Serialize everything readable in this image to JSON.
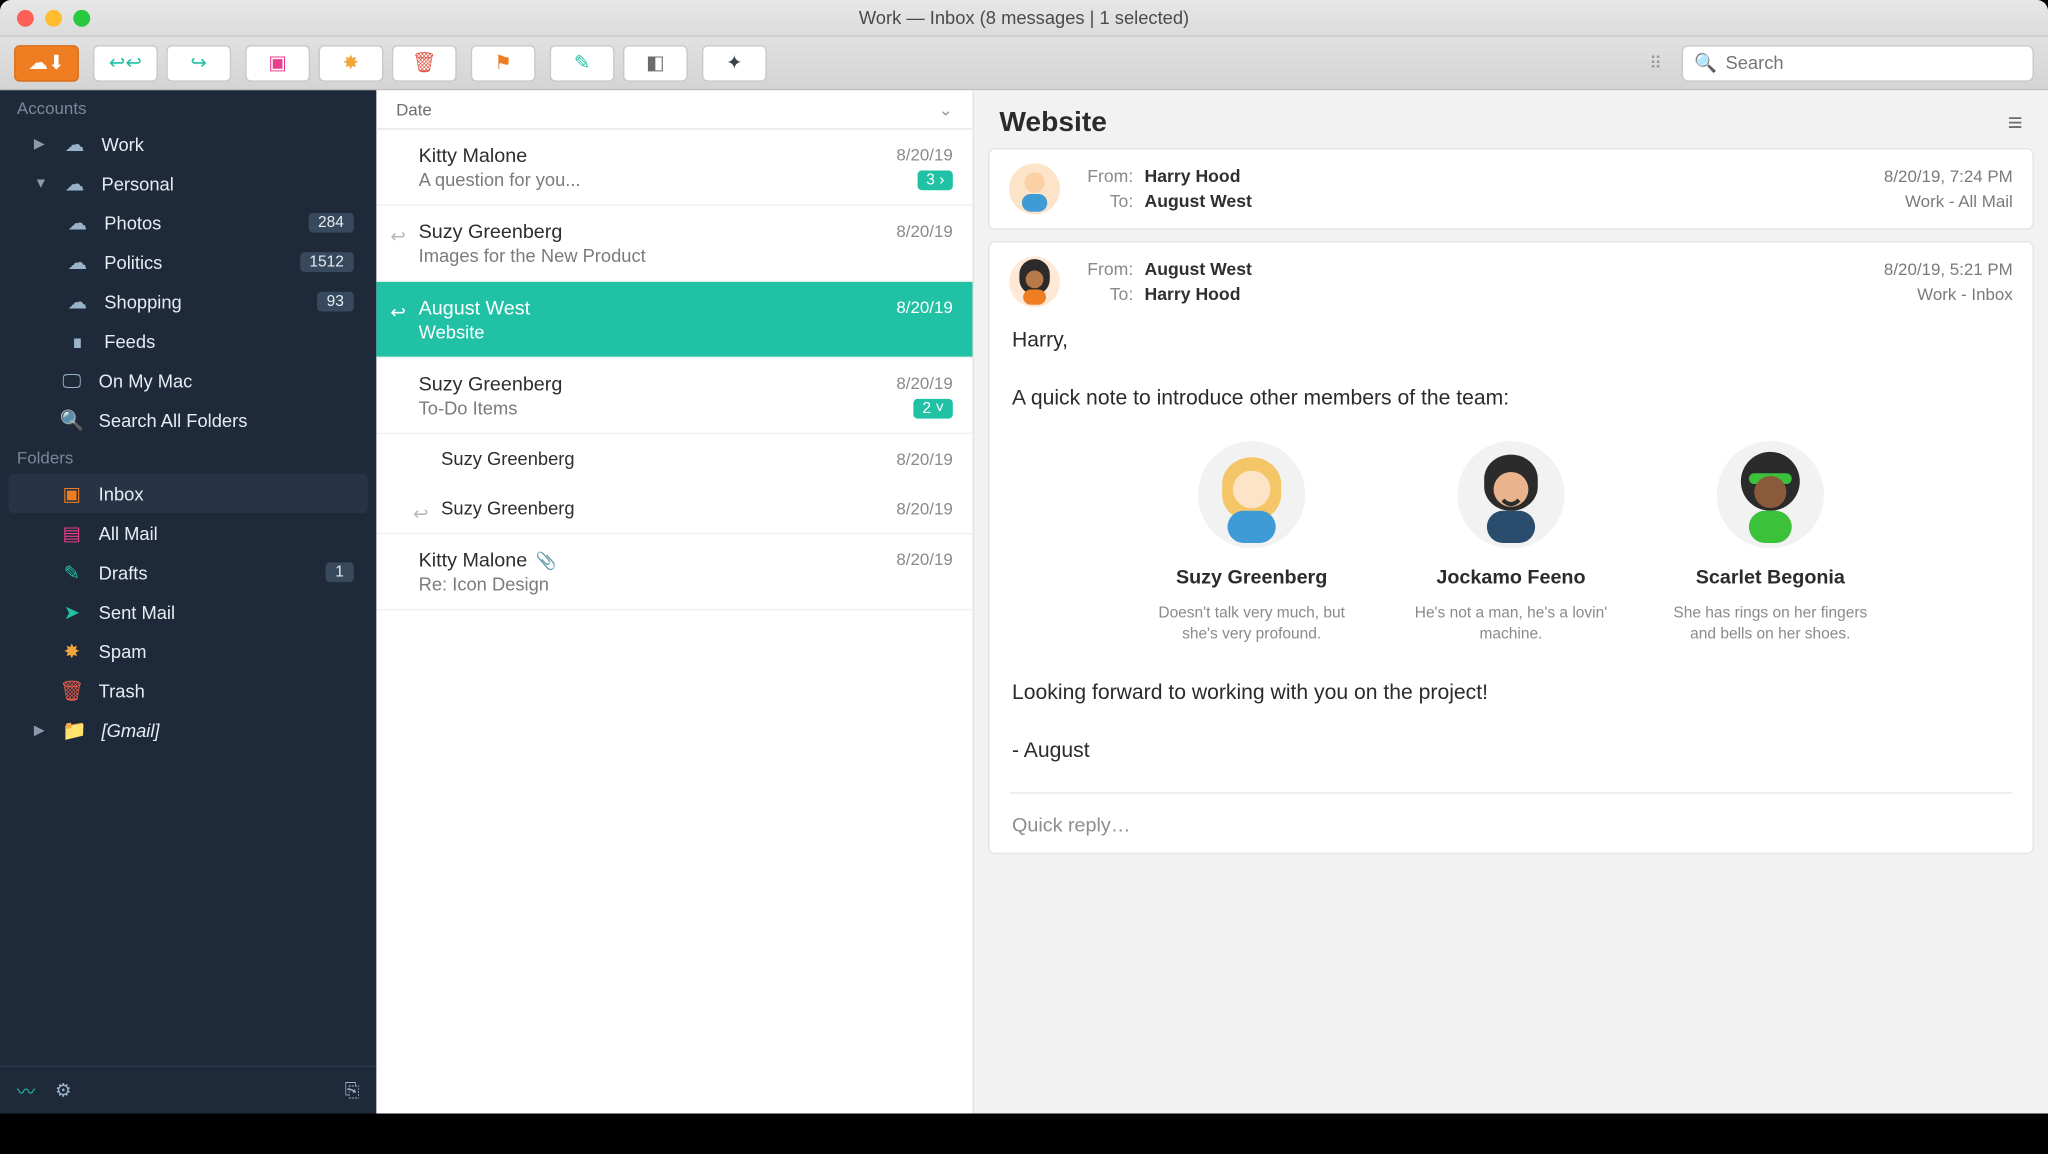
{
  "window": {
    "title": "Work — Inbox (8 messages | 1 selected)"
  },
  "toolbar": {
    "search_placeholder": "Search"
  },
  "sidebar": {
    "section_accounts": "Accounts",
    "section_folders": "Folders",
    "accounts": [
      {
        "label": "Work",
        "expandable": true,
        "expanded": false
      },
      {
        "label": "Personal",
        "expandable": true,
        "expanded": true,
        "children": [
          {
            "label": "Photos",
            "badge": "284",
            "icon": "cloud"
          },
          {
            "label": "Politics",
            "badge": "1512",
            "icon": "cloud"
          },
          {
            "label": "Shopping",
            "badge": "93",
            "icon": "cloud"
          },
          {
            "label": "Feeds",
            "badge": "",
            "icon": "rss"
          }
        ]
      }
    ],
    "on_my_mac": "On My Mac",
    "search_all": "Search All Folders",
    "folders": [
      {
        "label": "Inbox",
        "icon": "inbox",
        "selected": true,
        "color": "#ef7e23"
      },
      {
        "label": "All Mail",
        "icon": "archive",
        "selected": false,
        "color": "#e83e8c"
      },
      {
        "label": "Drafts",
        "icon": "pencil",
        "selected": false,
        "color": "#21c1a6",
        "badge": "1"
      },
      {
        "label": "Sent Mail",
        "icon": "send",
        "selected": false,
        "color": "#21c1a6"
      },
      {
        "label": "Spam",
        "icon": "warn",
        "selected": false,
        "color": "#f2a73b"
      },
      {
        "label": "Trash",
        "icon": "trash",
        "selected": false,
        "color": "#e25b4b"
      }
    ],
    "gmail_label": "[Gmail]"
  },
  "list": {
    "header": "Date",
    "messages": [
      {
        "sender": "Kitty Malone",
        "date": "8/20/19",
        "subject": "A question for you...",
        "pill": "3 ›"
      },
      {
        "sender": "Suzy Greenberg",
        "date": "8/20/19",
        "subject": "Images for the New Product",
        "reply": true
      },
      {
        "sender": "August West",
        "date": "8/20/19",
        "subject": "Website",
        "reply": true,
        "selected": true
      },
      {
        "sender": "Suzy Greenberg",
        "date": "8/20/19",
        "subject": "To-Do Items",
        "pill": "2 ˅"
      },
      {
        "sender": "Suzy Greenberg",
        "date": "8/20/19",
        "sub": true
      },
      {
        "sender": "Suzy Greenberg",
        "date": "8/20/19",
        "sub": true,
        "reply": true
      },
      {
        "sender": "Kitty Malone",
        "date": "8/20/19",
        "subject": "Re: Icon Design",
        "attach": true
      }
    ]
  },
  "reader": {
    "subject": "Website",
    "threads": [
      {
        "from_label": "From:",
        "to_label": "To:",
        "from": "Harry Hood",
        "to": "August West",
        "date": "8/20/19, 7:24 PM",
        "folder": "Work - All Mail"
      },
      {
        "from_label": "From:",
        "to_label": "To:",
        "from": "August West",
        "to": "Harry Hood",
        "date": "8/20/19, 5:21 PM",
        "folder": "Work - Inbox"
      }
    ],
    "body": {
      "greeting": "Harry,",
      "intro": "A quick note to introduce other members of the team:",
      "closing": "Looking forward to working with you on the project!",
      "signoff": "- August"
    },
    "team": [
      {
        "name": "Suzy Greenberg",
        "desc": "Doesn't talk very much, but she's very profound."
      },
      {
        "name": "Jockamo Feeno",
        "desc": "He's not a man, he's a lovin' machine."
      },
      {
        "name": "Scarlet Begonia",
        "desc": "She has rings on her fingers and bells on her shoes."
      }
    ],
    "quick_reply": "Quick reply…"
  }
}
